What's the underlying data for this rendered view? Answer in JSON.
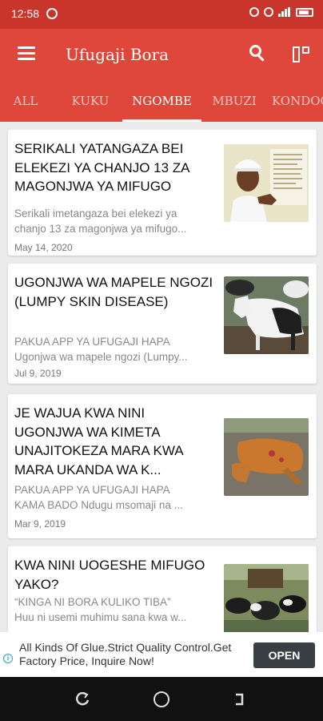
{
  "status_bar": {
    "time": "12:58"
  },
  "app_bar": {
    "title": "Ufugaji Bora"
  },
  "tabs": [
    {
      "label": "ALL"
    },
    {
      "label": "KUKU"
    },
    {
      "label": "NGOMBE"
    },
    {
      "label": "MBUZI"
    },
    {
      "label": "KONDOO"
    }
  ],
  "active_tab": "NGOMBE",
  "articles": [
    {
      "title": "SERIKALI YATANGAZA BEI ELEKEZI YA CHANJO 13 ZA MAGONJWA YA MIFUGO",
      "excerpt_lines": [
        "Serikali imetangaza bei elekezi ya",
        "chanjo 13 za magonjwa ya mifugo..."
      ],
      "date": "May 14, 2020"
    },
    {
      "title": "UGONJWA WA MAPELE NGOZI (LUMPY SKIN DISEASE)",
      "excerpt_lines": [
        "PAKUA APP YA UFUGAJI HAPA",
        "Ugonjwa wa mapele ngozi (Lumpy..."
      ],
      "date": "Jul 9, 2019"
    },
    {
      "title": "JE WAJUA KWA NINI UGONJWA WA KIMETA UNAJITOKEZA MARA KWA MARA UKANDA WA K...",
      "excerpt_lines": [
        "PAKUA APP YA UFUGAJI HAPA",
        "KAMA BADO Ndugu msomaji na ..."
      ],
      "date": "Mar 9, 2019"
    },
    {
      "title": "KWA NINI UOGESHE MIFUGO YAKO?",
      "excerpt_lines": [
        "“KINGA NI BORA KULIKO TIBA”",
        "Huu ni usemi muhimu sana kwa w..."
      ],
      "date": ""
    }
  ],
  "ad": {
    "text": "All Kinds Of Glue.Strict Quality Control.Get Factory Price, Inquire Now!",
    "button_label": "OPEN"
  },
  "colors": {
    "status_bar": "#c9352a",
    "app_bar": "#e0473b",
    "background": "#ebebeb"
  }
}
